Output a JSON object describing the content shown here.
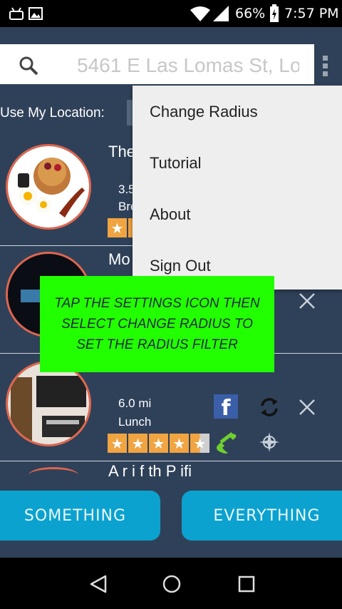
{
  "status_bar": {
    "battery": "66%",
    "time": "7:57 PM"
  },
  "search": {
    "value": "5461 E Las Lomas St, Lo",
    "placeholder": ""
  },
  "location": {
    "label": "Use My Location:"
  },
  "menu": {
    "items": [
      {
        "label": "Change Radius"
      },
      {
        "label": "Tutorial"
      },
      {
        "label": "About"
      },
      {
        "label": "Sign Out"
      }
    ]
  },
  "tutorial_tip": "TAP THE SETTINGS ICON THEN SELECT CHANGE RADIUS TO SET THE RADIUS FILTER",
  "list": [
    {
      "title": "The",
      "distance": "3.5",
      "category": "Bre",
      "rating": 4.5
    },
    {
      "title": "Mo",
      "distance": "",
      "category": "",
      "rating": 0
    },
    {
      "title": "",
      "distance": "6.0 mi",
      "category": "Lunch",
      "rating": 4.5
    },
    {
      "title": "A   r i   f th  P  ifi",
      "distance": "",
      "category": "",
      "rating": 0
    }
  ],
  "buttons": {
    "something": "SOMETHING",
    "everything": "EVERYTHING"
  },
  "colors": {
    "accent": "#0ba2cf",
    "background": "#2f4159",
    "tip": "#22ff00",
    "avatar_border": "#e0664e",
    "star": "#f0a442"
  }
}
